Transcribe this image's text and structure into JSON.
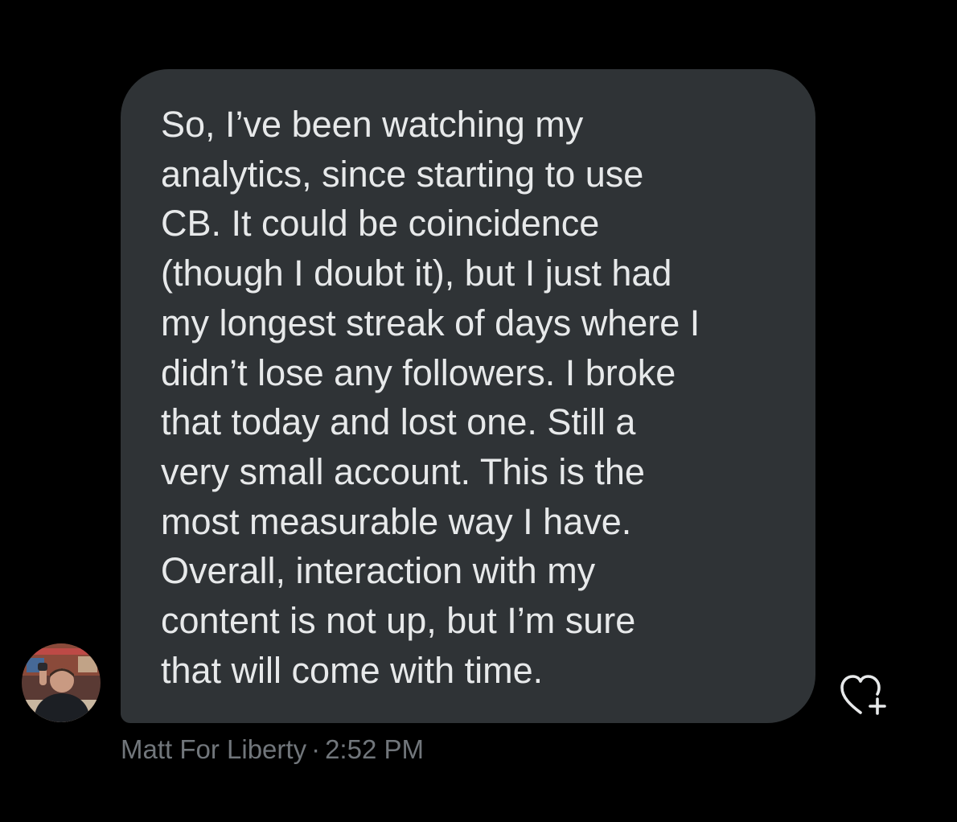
{
  "message": {
    "lines": [
      "So, I’ve been watching my",
      "analytics, since starting to use",
      "CB. It could be coincidence",
      "(though I doubt it), but I just had",
      "my longest streak of days where I",
      "didn’t lose any followers. I broke",
      "that today and lost one. Still a",
      "very small account. This is the",
      "most measurable way I have.",
      "Overall, interaction with my",
      "content is not up, but I’m sure",
      "that will come with time."
    ],
    "sender": "Matt For Liberty",
    "separator": "·",
    "time": "2:52 PM",
    "bubble_color": "#2f3336",
    "text_color": "#e7e9ea",
    "meta_color": "#71767b"
  },
  "icons": {
    "avatar": "user-avatar-photo",
    "reaction": "heart-plus-icon"
  }
}
